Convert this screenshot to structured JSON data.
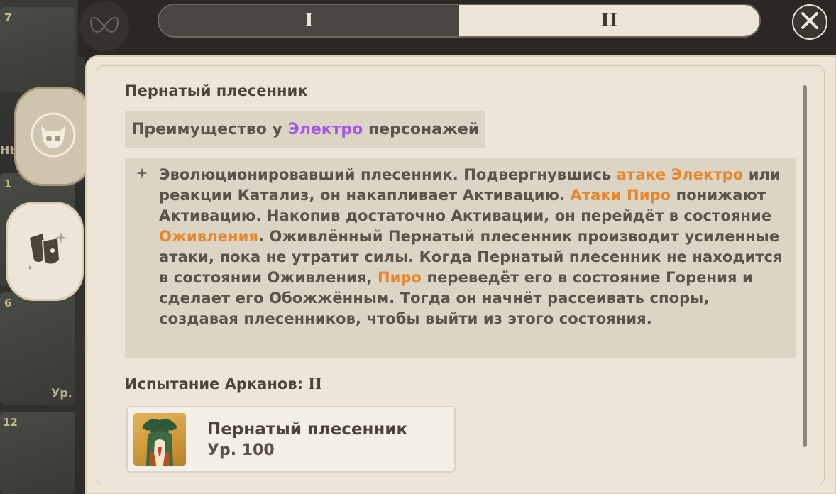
{
  "tabs": [
    {
      "label": "I",
      "active": false
    },
    {
      "label": "II",
      "active": true
    }
  ],
  "background": {
    "card_numbers": [
      "7",
      "1",
      "6",
      "12"
    ],
    "partial_labels": [
      "НЬ",
      "Ур."
    ]
  },
  "sidebar": {
    "items": [
      {
        "icon": "monster-skull-icon",
        "selected": false
      },
      {
        "icon": "mask-effects-icon",
        "selected": true
      }
    ]
  },
  "enemy": {
    "title": "Пернатый плесенник",
    "advantage": {
      "prefix": "Преимущество у ",
      "element": "Электро",
      "suffix": " персонажей",
      "element_color": "#a457e0"
    },
    "description": [
      {
        "t": "Эволюционировавший плесенник. Подвергнувшись ",
        "hl": false
      },
      {
        "t": "атаке Электро",
        "hl": true
      },
      {
        "t": " или реакции Катализ, он накапливает Активацию. ",
        "hl": false
      },
      {
        "t": "Атаки Пиро",
        "hl": true
      },
      {
        "t": " понижают Активацию. Накопив достаточно Активации, он перейдёт в состояние ",
        "hl": false
      },
      {
        "t": "Оживления",
        "hl": true
      },
      {
        "t": ". Оживлённый Пернатый плесенник производит усиленные атаки, пока не утратит силы. Когда Пернатый плесенник не находится в состоянии Оживления, ",
        "hl": false
      },
      {
        "t": "Пиро",
        "hl": true
      },
      {
        "t": " переведёт его в состояние Горения и сделает его Обожжённым. Тогда он начнёт рассеивать споры, создавая плесенников, чтобы выйти из этого состояния.",
        "hl": false
      }
    ],
    "highlight_color": "#e8862a"
  },
  "trial": {
    "title": "Испытание Арканов:",
    "level_mark": "II",
    "enemy_card": {
      "name": "Пернатый плесенник",
      "level": "Ур. 100"
    }
  },
  "colors": {
    "panel": "#ece5d8",
    "text": "#5b5249",
    "tab_active": "#ece5d8",
    "tab_inactive": "#4a4540"
  }
}
